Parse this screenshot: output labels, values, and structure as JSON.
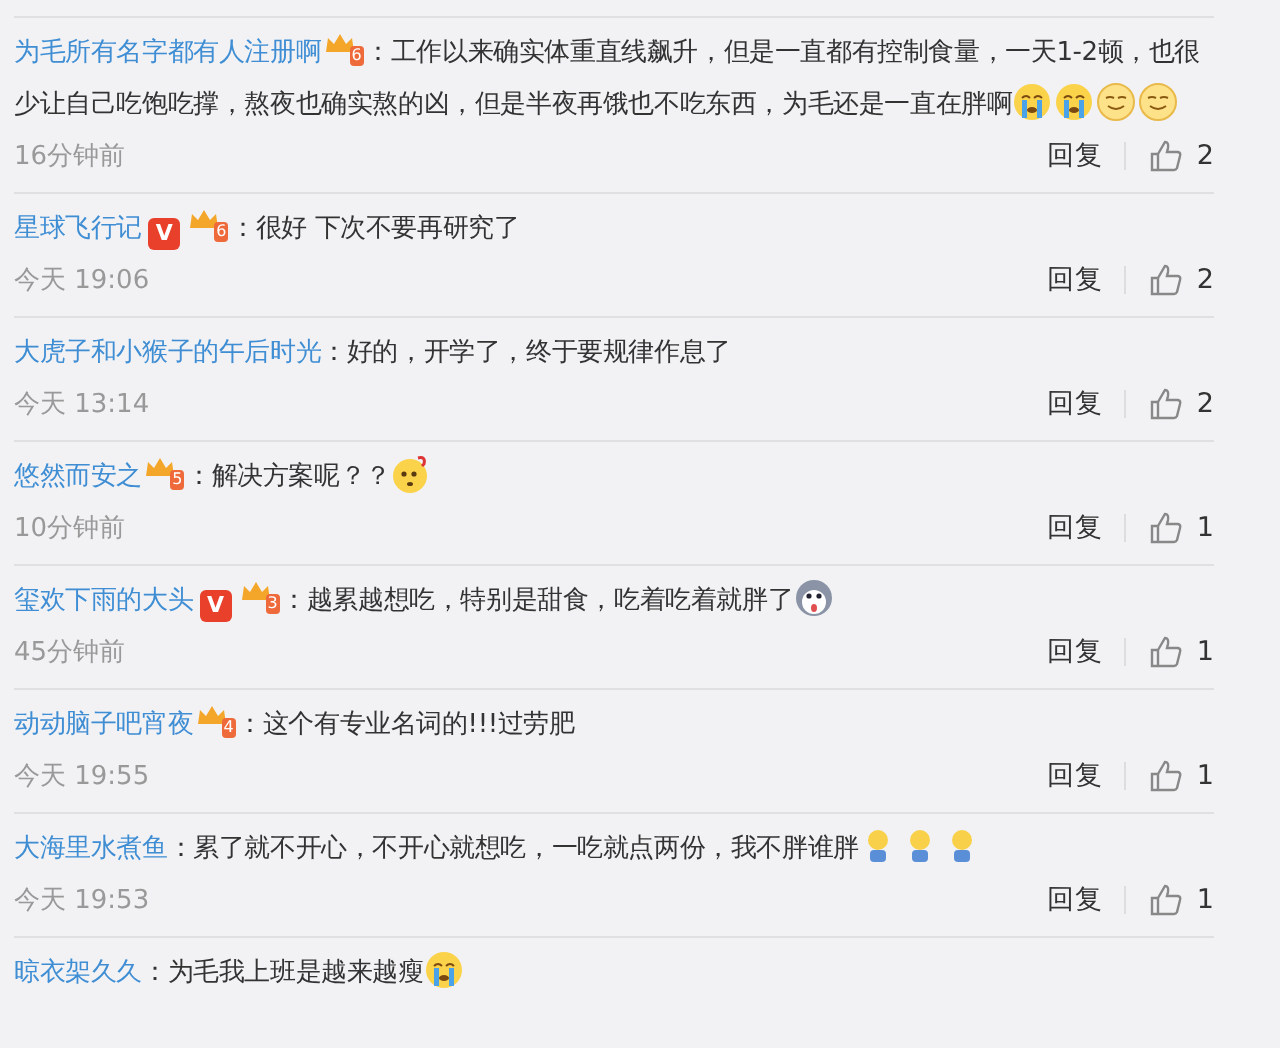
{
  "comments": [
    {
      "user": "为毛所有名字都有人注册啊",
      "badges": [
        {
          "kind": "level",
          "label": "6"
        }
      ],
      "text": "：工作以来确实体重直线飙升，但是一直都有控制食量，一天1-2顿，也很少让自己吃饱吃撑，熬夜也确实熬的凶，但是半夜再饿也不吃东西，为毛还是一直在胖啊",
      "emojis": [
        {
          "kind": "crying"
        },
        {
          "kind": "crying"
        },
        {
          "kind": "smile"
        },
        {
          "kind": "smile"
        }
      ],
      "time": "16分钟前",
      "reply": "回复",
      "likes": "2"
    },
    {
      "user": "星球飞行记",
      "badges": [
        {
          "kind": "vip",
          "label": "V"
        },
        {
          "kind": "level",
          "label": "6"
        }
      ],
      "text": "：很好 下次不要再研究了",
      "time": "今天 19:06",
      "reply": "回复",
      "likes": "2"
    },
    {
      "user": "大虎子和小猴子的午后时光",
      "text": "：好的，开学了，终于要规律作息了",
      "time": "今天 13:14",
      "reply": "回复",
      "likes": "2"
    },
    {
      "user": "悠然而安之",
      "badges": [
        {
          "kind": "level",
          "label": "5"
        }
      ],
      "text": "：解决方案呢？？",
      "emojis": [
        {
          "kind": "thinking"
        }
      ],
      "time": "10分钟前",
      "reply": "回复",
      "likes": "1"
    },
    {
      "user": "玺欢下雨的大头",
      "badges": [
        {
          "kind": "vip",
          "label": "V"
        },
        {
          "kind": "level",
          "label": "3"
        }
      ],
      "text": "：越累越想吃，特别是甜食，吃着吃着就胖了",
      "emojis": [
        {
          "kind": "husky"
        }
      ],
      "time": "45分钟前",
      "reply": "回复",
      "likes": "1"
    },
    {
      "user": "动动脑子吧宵夜",
      "badges": [
        {
          "kind": "level",
          "label": "4"
        }
      ],
      "text": "：这个有专业名词的!!!过劳肥",
      "time": "今天 19:55",
      "reply": "回复",
      "likes": "1"
    },
    {
      "user": "大海里水煮鱼",
      "text": "：累了就不开心，不开心就想吃，一吃就点两份，我不胖谁胖",
      "emojis": [
        {
          "kind": "figure"
        },
        {
          "kind": "figure"
        },
        {
          "kind": "figure"
        }
      ],
      "time": "今天 19:53",
      "reply": "回复",
      "likes": "1"
    },
    {
      "user": "晾衣架久久",
      "text": "：为毛我上班是越来越瘦",
      "emojis": [
        {
          "kind": "crying"
        }
      ]
    }
  ]
}
